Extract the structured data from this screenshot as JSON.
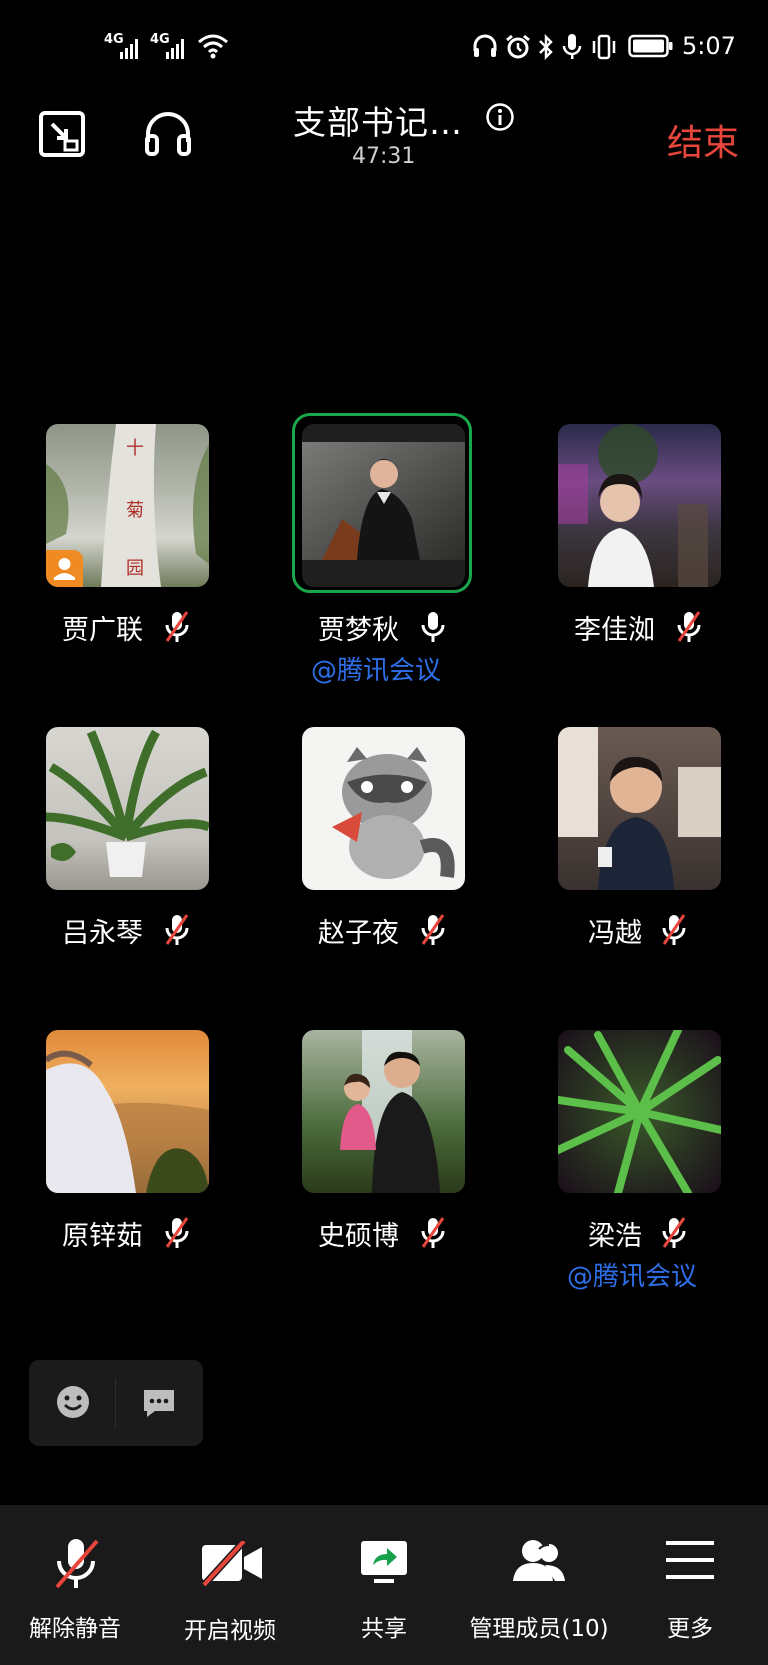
{
  "status_bar": {
    "signal1": "4G",
    "signal2": "4G",
    "time": "5:07"
  },
  "header": {
    "title": "支部书记…",
    "elapsed": "47:31",
    "end_label": "结束"
  },
  "participants": [
    {
      "name": "贾广联",
      "mic": "muted",
      "tag": "",
      "host": true
    },
    {
      "name": "贾梦秋",
      "mic": "on",
      "tag": "@腾讯会议",
      "speaking": true
    },
    {
      "name": "李佳洳",
      "mic": "muted",
      "tag": ""
    },
    {
      "name": "吕永琴",
      "mic": "muted",
      "tag": ""
    },
    {
      "name": "赵子夜",
      "mic": "muted",
      "tag": ""
    },
    {
      "name": "冯越",
      "mic": "muted",
      "tag": ""
    },
    {
      "name": "原锌茹",
      "mic": "muted",
      "tag": ""
    },
    {
      "name": "史硕博",
      "mic": "muted",
      "tag": ""
    },
    {
      "name": "梁浩",
      "mic": "muted",
      "tag": "@腾讯会议"
    }
  ],
  "toolbar": {
    "unmute": "解除静音",
    "video": "开启视频",
    "share": "共享",
    "members": "管理成员(10)",
    "more": "更多"
  },
  "colors": {
    "end": "#e8463c",
    "speaking_border": "#1aa64a",
    "link_tag": "#2e6fe8",
    "mute_slash": "#e8463c"
  }
}
